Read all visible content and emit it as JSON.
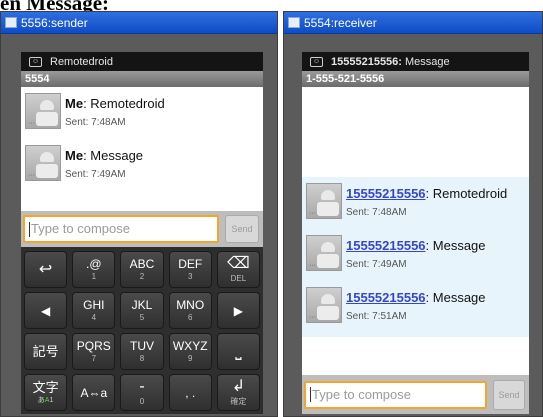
{
  "page": {
    "cropped_title": "en Message:"
  },
  "sender": {
    "window_title": "5556:sender",
    "notification": {
      "text": "Remotedroid"
    },
    "conversation_header": "5554",
    "messages": [
      {
        "from": "Me",
        "text": ": Remotedroid",
        "sent": "Sent: 7:48AM"
      },
      {
        "from": "Me",
        "text": ": Message",
        "sent": "Sent: 7:49AM"
      }
    ],
    "compose_placeholder": "Type to compose",
    "send_label": "Send",
    "keyboard": {
      "row1": [
        {
          "main": "↩",
          "sub": ""
        },
        {
          "main": ".@",
          "sub": "1"
        },
        {
          "main": "ABC",
          "sub": "2"
        },
        {
          "main": "DEF",
          "sub": "3"
        },
        {
          "main": "⌫",
          "sub": "DEL"
        }
      ],
      "row2": [
        {
          "main": "◀",
          "sub": ""
        },
        {
          "main": "GHI",
          "sub": "4"
        },
        {
          "main": "JKL",
          "sub": "5"
        },
        {
          "main": "MNO",
          "sub": "6"
        },
        {
          "main": "▶",
          "sub": ""
        }
      ],
      "row3": [
        {
          "main": "記号",
          "sub": ""
        },
        {
          "main": "PQRS",
          "sub": "7"
        },
        {
          "main": "TUV",
          "sub": "8"
        },
        {
          "main": "WXYZ",
          "sub": "9"
        },
        {
          "main": "⎵",
          "sub": ""
        }
      ],
      "row4": [
        {
          "main": "文字",
          "sub_a": "あ",
          "sub_b": "A",
          "sub_c": "1"
        },
        {
          "main": "A⇔a",
          "sub": ""
        },
        {
          "main": "-",
          "sub": "0"
        },
        {
          "main": ", .",
          "sub": ""
        },
        {
          "main": "↲",
          "sub": "確定"
        }
      ]
    }
  },
  "receiver": {
    "window_title": "5554:receiver",
    "notification": {
      "sender": "15555215556:",
      "text": "Message"
    },
    "conversation_header": "1-555-521-5556",
    "messages": [
      {
        "from": "15555215556",
        "text": ": Remotedroid",
        "sent": "Sent: 7:48AM"
      },
      {
        "from": "15555215556",
        "text": ": Message",
        "sent": "Sent: 7:49AM"
      },
      {
        "from": "15555215556",
        "text": ": Message",
        "sent": "Sent: 7:51AM"
      }
    ],
    "compose_placeholder": "Type to compose",
    "send_label": "Send"
  }
}
